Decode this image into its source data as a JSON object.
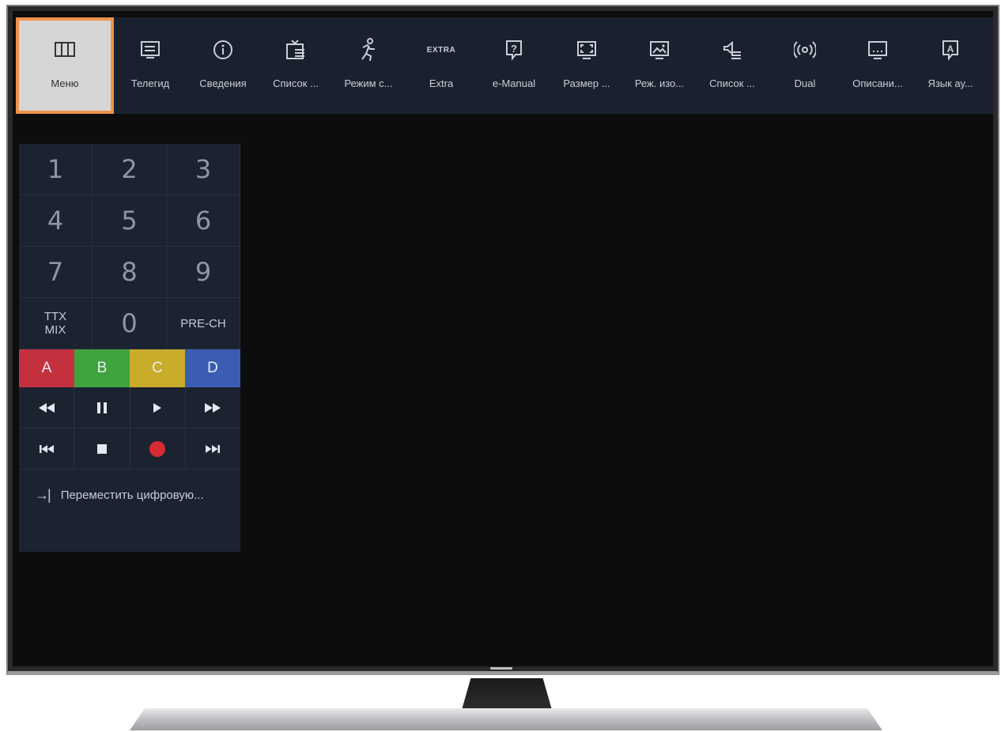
{
  "menu": {
    "items": [
      {
        "label": "Меню",
        "icon": "grid-icon",
        "selected": true
      },
      {
        "label": "Телегид",
        "icon": "guide-icon"
      },
      {
        "label": "Сведения",
        "icon": "info-icon"
      },
      {
        "label": "Список ...",
        "icon": "channel-list-icon"
      },
      {
        "label": "Режим с...",
        "icon": "sport-mode-icon"
      },
      {
        "label": "Extra",
        "icon": "extra-icon",
        "icon_text": "EXTRA"
      },
      {
        "label": "e-Manual",
        "icon": "e-manual-icon"
      },
      {
        "label": "Размер ...",
        "icon": "picture-size-icon"
      },
      {
        "label": "Реж. изо...",
        "icon": "picture-mode-icon"
      },
      {
        "label": "Список ...",
        "icon": "sound-list-icon"
      },
      {
        "label": "Dual",
        "icon": "dual-icon"
      },
      {
        "label": "Описани...",
        "icon": "description-icon"
      },
      {
        "label": "Язык ау...",
        "icon": "audio-language-icon"
      }
    ],
    "selected_color": "#f0924a"
  },
  "remote": {
    "digits": [
      "1",
      "2",
      "3",
      "4",
      "5",
      "6",
      "7",
      "8",
      "9"
    ],
    "ttx_line1": "TTX",
    "ttx_line2": "MIX",
    "zero": "0",
    "prech": "PRE-CH",
    "color_keys": [
      {
        "label": "A",
        "color": "#c4303e"
      },
      {
        "label": "B",
        "color": "#3fa33e"
      },
      {
        "label": "C",
        "color": "#c9ac2a"
      },
      {
        "label": "D",
        "color": "#3a5db3"
      }
    ],
    "playback": [
      "rewind-icon",
      "pause-icon",
      "play-icon",
      "fast-forward-icon"
    ],
    "transport": [
      "previous-icon",
      "stop-icon",
      "record-icon",
      "next-icon"
    ],
    "move_label": "Переместить цифровую..."
  }
}
